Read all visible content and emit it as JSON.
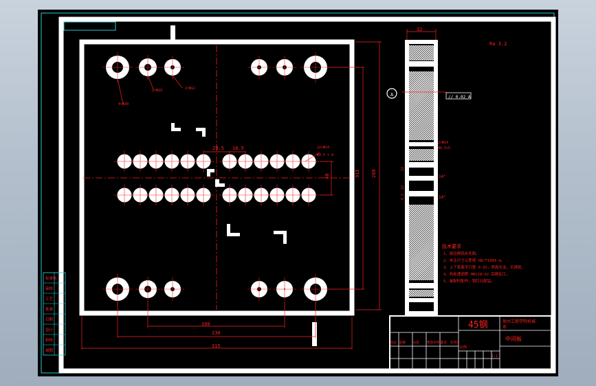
{
  "drawing": {
    "material": "45钢",
    "part_name": "中间板",
    "title_header": "徐州工程学院机械",
    "title_header_2": "系",
    "roughness": "Ra 3.2",
    "side_ref_label": "A",
    "flatness_tol": "// 0.02 A"
  },
  "dimensions": {
    "top_32": "32",
    "w_29_5": "29.5",
    "w_18_5": "18.5",
    "h_40": "40",
    "h_260": "260",
    "h_315": "315",
    "w_160": "160",
    "w_230": "230",
    "w_315": "315",
    "hole_small_a": "2×Φ10",
    "hole_small_b": "2×Φ12",
    "hole_big": "4×Φ30",
    "hole_row_a": "22×Φ14",
    "hole_row_b": "Φ8.5 × 8",
    "side_hole_a": "2×Φ14",
    "side_hole_b": "Φ6.5×5",
    "side_a": "22",
    "side_b": "6.2",
    "side_c": "14°"
  },
  "notes": {
    "title": "技术要求",
    "lines": [
      "1、锐边倒钝去毛刺。",
      "2、未注尺寸公差按 GB/T1804-m。",
      "3、上下表面平行度 0.02，表面光洁，无锈斑。",
      "4、热处理调质 HRC28~32 后精加工。",
      "5、装配时配作，销钉孔配钻。"
    ]
  },
  "left_block": {
    "rows": [
      "标准化",
      "审核",
      "工艺",
      "批准",
      "日期",
      "设计",
      "校核",
      "描图"
    ]
  },
  "title_block": {
    "cells": [
      "标记",
      "处数",
      "分区",
      "更改文件号",
      "签名",
      "年月日"
    ],
    "scale_label": "比例",
    "scale_value": "1:1"
  }
}
